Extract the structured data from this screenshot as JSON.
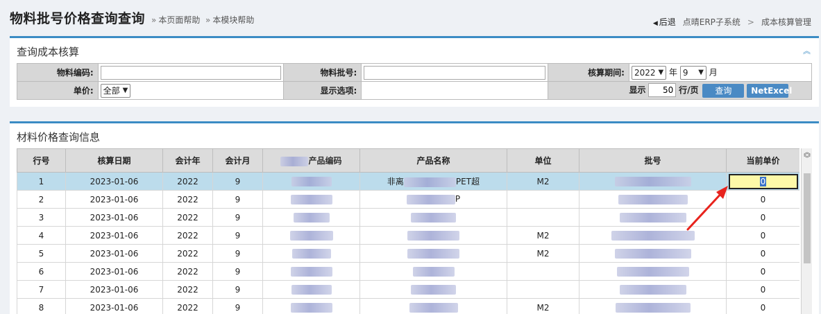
{
  "header": {
    "title": "物料批号价格查询查询",
    "help_page": "本页面帮助",
    "help_module": "本模块帮助",
    "back": "后退",
    "crumb_1": "点晴ERP子系统",
    "crumb_sep": ">",
    "crumb_2": "成本核算管理"
  },
  "query_panel": {
    "title": "查询成本核算",
    "material_code_label": "物料编码:",
    "material_code_value": "",
    "batch_no_label": "物料批号:",
    "batch_no_value": "",
    "period_label": "核算期间:",
    "year_value": "2022",
    "year_unit": "年",
    "month_value": "9",
    "month_unit": "月",
    "price_label": "单价:",
    "price_value": "全部",
    "display_option_label": "显示选项:",
    "show_label": "显示",
    "rows_per_page": "50",
    "rows_unit": "行/页",
    "query_button": "查询",
    "netexcel_button": "NetExcel"
  },
  "result_panel": {
    "title": "材料价格查询信息",
    "columns": [
      "行号",
      "核算日期",
      "会计年",
      "会计月",
      "产品编码",
      "产品名称",
      "单位",
      "批号",
      "当前单价"
    ],
    "rows": [
      {
        "no": "1",
        "date": "2023-01-06",
        "year": "2022",
        "month": "9",
        "unit": "M2",
        "name_hint": "非离",
        "name_tail": "PET超",
        "price": "0"
      },
      {
        "no": "2",
        "date": "2023-01-06",
        "year": "2022",
        "month": "9",
        "unit": "",
        "name_hint": "",
        "name_tail": "P",
        "price": "0"
      },
      {
        "no": "3",
        "date": "2023-01-06",
        "year": "2022",
        "month": "9",
        "unit": "",
        "name_hint": "",
        "name_tail": "",
        "price": "0"
      },
      {
        "no": "4",
        "date": "2023-01-06",
        "year": "2022",
        "month": "9",
        "unit": "M2",
        "name_hint": "",
        "name_tail": "",
        "price": "0"
      },
      {
        "no": "5",
        "date": "2023-01-06",
        "year": "2022",
        "month": "9",
        "unit": "M2",
        "name_hint": "",
        "name_tail": "",
        "price": "0"
      },
      {
        "no": "6",
        "date": "2023-01-06",
        "year": "2022",
        "month": "9",
        "unit": "",
        "name_hint": "",
        "name_tail": "",
        "price": "0"
      },
      {
        "no": "7",
        "date": "2023-01-06",
        "year": "2022",
        "month": "9",
        "unit": "",
        "name_hint": "",
        "name_tail": "",
        "price": "0"
      },
      {
        "no": "8",
        "date": "2023-01-06",
        "year": "2022",
        "month": "9",
        "unit": "M2",
        "name_hint": "",
        "name_tail": "",
        "price": "0"
      }
    ]
  },
  "colors": {
    "accent": "#3b8cc4",
    "selected_row": "#bcdcec",
    "editing_cell": "#fdf9a8",
    "annotation_arrow": "#e8231d"
  }
}
